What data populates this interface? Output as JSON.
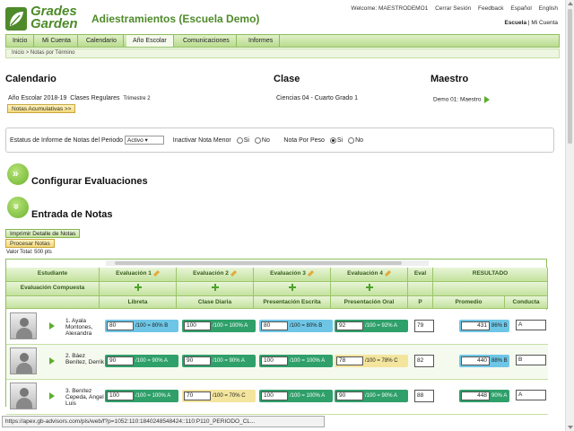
{
  "app": {
    "logo_line1": "Grades",
    "logo_line2": "Garden",
    "title": "Adiestramientos (Escuela Demo)"
  },
  "toplinks": {
    "welcome": "Welcome: MAESTRODEMO1",
    "logout": "Cerrar Sesión",
    "feedback": "Feedback",
    "lang_es": "Español",
    "lang_en": "English",
    "escuela": "Escuela",
    "mi_cuenta": "Mi Cuenta"
  },
  "nav": [
    "Inicio",
    "Mi Cuenta",
    "Calendario",
    "Año Escolar",
    "Comunicaciones",
    "Informes"
  ],
  "breadcrumb": {
    "home": "Inicio",
    "current": "Notas por Término"
  },
  "calendario": {
    "heading": "Calendario",
    "year": "Año Escolar 2018-19",
    "classes": "Clases Regulares",
    "term": "Trimestre 2",
    "button": "Notas Acumulativas >>"
  },
  "clase": {
    "heading": "Clase",
    "value": "Ciencias 04 -   Cuarto Grado  1"
  },
  "maestro": {
    "heading": "Maestro",
    "value": "Demo 01: Maestro"
  },
  "filters": {
    "estatus_label": "Estatus de Informe de Notas del Periodo",
    "estatus_value": "Activo",
    "inactivar_label": "Inactivar Nota Menor",
    "peso_label": "Nota Por Peso",
    "si": "Si",
    "no": "No"
  },
  "sections": {
    "configurar": "Configurar Evaluaciones",
    "entrada": "Entrada de Notas"
  },
  "actions": {
    "imprimir": "Imprimir Detalle de Notas",
    "procesar": "Procesar Notas",
    "valor_total": "Valor Total: 500 pts"
  },
  "table": {
    "h_estudiante": "Estudiante",
    "h_compuesta": "Evaluación Compuesta",
    "h_resultado": "RESULTADO",
    "evals": [
      "Evaluación 1",
      "Evaluación 2",
      "Evaluación 3",
      "Evaluación 4",
      "Eval"
    ],
    "cols": [
      "Libreta",
      "Clase Diaria",
      "Presentación Escrita",
      "Presentación Oral",
      "P"
    ],
    "h_promedio": "Promedio",
    "h_conducta": "Conducta",
    "rows": [
      {
        "name": "1. Ayala Montones, Alexandra",
        "grades": [
          {
            "v": "80",
            "t": "/100 = 80% B",
            "c": "blue"
          },
          {
            "v": "100",
            "t": "/100 = 100% A",
            "c": "green"
          },
          {
            "v": "80",
            "t": "/100 = 80% B",
            "c": "blue"
          },
          {
            "v": "92",
            "t": "/100 = 92% A",
            "c": "green"
          }
        ],
        "partial": "79",
        "promedio": "431",
        "pct": "86% B",
        "pcolor": "blue",
        "conducta": "A"
      },
      {
        "name": "2. Báez Benítez, Derrik",
        "grades": [
          {
            "v": "90",
            "t": "/100 = 90% A",
            "c": "green"
          },
          {
            "v": "90",
            "t": "/100 = 90% A",
            "c": "green"
          },
          {
            "v": "100",
            "t": "/100 = 100% A",
            "c": "green"
          },
          {
            "v": "78",
            "t": "/100 = 78% C",
            "c": "yellow"
          }
        ],
        "partial": "82",
        "promedio": "440",
        "pct": "88% B",
        "pcolor": "blue",
        "conducta": "B"
      },
      {
        "name": "3. Benítez Cepeda, Angel Luis",
        "grades": [
          {
            "v": "100",
            "t": "/100 = 100% A",
            "c": "green"
          },
          {
            "v": "70",
            "t": "/100 = 70% C",
            "c": "yellow"
          },
          {
            "v": "100",
            "t": "/100 = 100% A",
            "c": "green"
          },
          {
            "v": "90",
            "t": "/100 = 90% A",
            "c": "green"
          }
        ],
        "partial": "88",
        "promedio": "448",
        "pct": "90% A",
        "pcolor": "green",
        "conducta": "A"
      }
    ]
  },
  "statusbar": "https://apex.gb-advisors.com/pls/web/f?p=1052:110:1840248548424::110:P110_PERIODO_CL..."
}
